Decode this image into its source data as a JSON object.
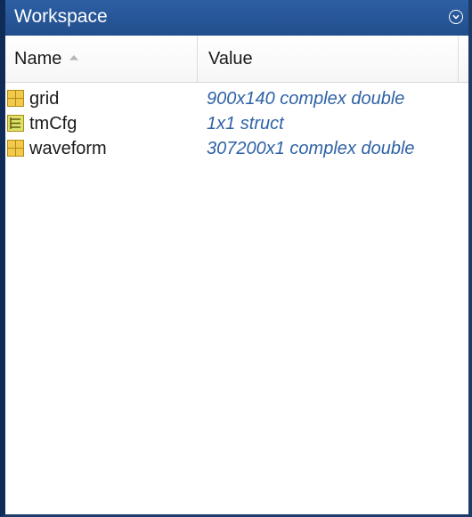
{
  "panel": {
    "title": "Workspace",
    "menu_icon": "circle-chevron-down-icon"
  },
  "columns": {
    "name_label": "Name",
    "value_label": "Value",
    "sort_indicator": "sort-ascending-icon"
  },
  "variables": [
    {
      "name": "grid",
      "value": "900x140 complex double",
      "icon": "matrix-icon"
    },
    {
      "name": "tmCfg",
      "value": "1x1 struct",
      "icon": "struct-icon"
    },
    {
      "name": "waveform",
      "value": "307200x1 complex double",
      "icon": "matrix-icon"
    }
  ],
  "colors": {
    "titlebar": "#2c5fa3",
    "value_text": "#2f62a6",
    "icon_fill": "#f2c94c",
    "icon_border": "#b58a12",
    "struct_icon_fill": "#d8e36a"
  }
}
